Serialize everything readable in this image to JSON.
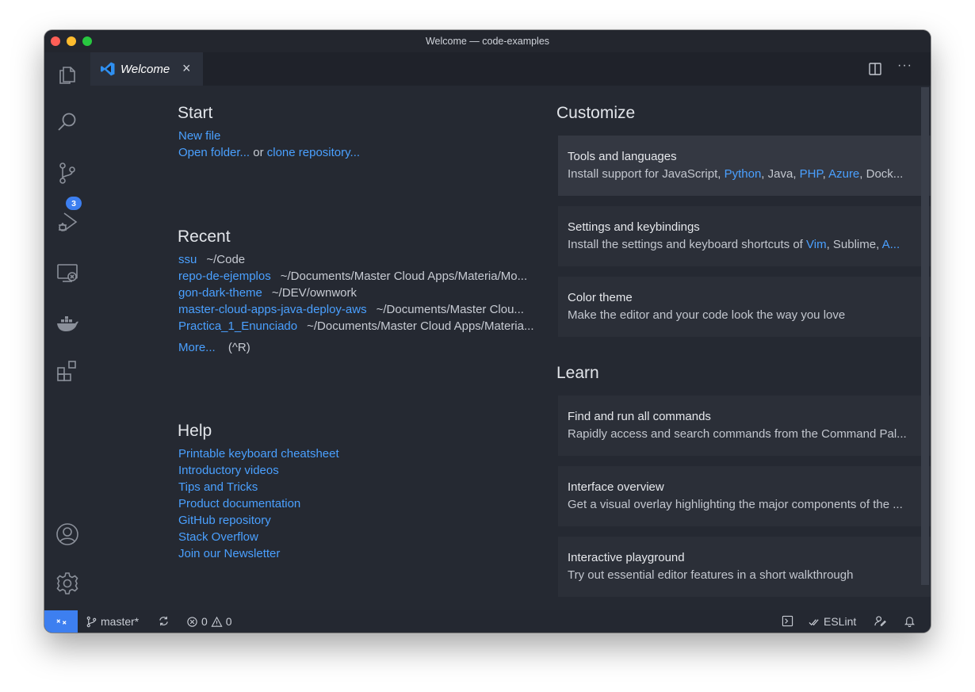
{
  "window": {
    "title": "Welcome — code-examples"
  },
  "activity_bar": {
    "items": [
      "files-icon",
      "search-icon",
      "source-control-icon",
      "run-debug-icon",
      "remote-explorer-icon",
      "docker-icon",
      "extensions-icon"
    ],
    "source_control_badge": "3",
    "bottom": [
      "account-icon",
      "settings-gear-icon"
    ]
  },
  "tabs": [
    {
      "label": "Welcome",
      "close": "×"
    }
  ],
  "tab_actions": {
    "more": "···"
  },
  "start": {
    "heading": "Start",
    "new_file": "New file",
    "open_folder": "Open folder...",
    "or": "or",
    "clone": "clone repository..."
  },
  "recent": {
    "heading": "Recent",
    "items": [
      {
        "name": "ssu",
        "path": "~/Code"
      },
      {
        "name": "repo-de-ejemplos",
        "path": "~/Documents/Master Cloud Apps/Materia/Mo..."
      },
      {
        "name": "gon-dark-theme",
        "path": "~/DEV/ownwork"
      },
      {
        "name": "master-cloud-apps-java-deploy-aws",
        "path": "~/Documents/Master Clou..."
      },
      {
        "name": "Practica_1_Enunciado",
        "path": "~/Documents/Master Cloud Apps/Materia..."
      }
    ],
    "more": "More...",
    "more_shortcut": "(^R)"
  },
  "help": {
    "heading": "Help",
    "links": [
      "Printable keyboard cheatsheet",
      "Introductory videos",
      "Tips and Tricks",
      "Product documentation",
      "GitHub repository",
      "Stack Overflow",
      "Join our Newsletter"
    ]
  },
  "customize": {
    "heading": "Customize",
    "cards": [
      {
        "title": "Tools and languages",
        "desc_parts": [
          {
            "t": "Install support for JavaScript, ",
            "link": false
          },
          {
            "t": "Python",
            "link": true
          },
          {
            "t": ", Java, ",
            "link": false
          },
          {
            "t": "PHP",
            "link": true
          },
          {
            "t": ", ",
            "link": false
          },
          {
            "t": "Azure",
            "link": true
          },
          {
            "t": ", Dock...",
            "link": false
          }
        ]
      },
      {
        "title": "Settings and keybindings",
        "desc_parts": [
          {
            "t": "Install the settings and keyboard shortcuts of ",
            "link": false
          },
          {
            "t": "Vim",
            "link": true
          },
          {
            "t": ", Sublime, ",
            "link": false
          },
          {
            "t": "A...",
            "link": true
          }
        ]
      },
      {
        "title": "Color theme",
        "desc_parts": [
          {
            "t": "Make the editor and your code look the way you love",
            "link": false
          }
        ]
      }
    ]
  },
  "learn": {
    "heading": "Learn",
    "cards": [
      {
        "title": "Find and run all commands",
        "desc": "Rapidly access and search commands from the Command Pal..."
      },
      {
        "title": "Interface overview",
        "desc": "Get a visual overlay highlighting the major components of the ..."
      },
      {
        "title": "Interactive playground",
        "desc": "Try out essential editor features in a short walkthrough"
      }
    ]
  },
  "status_bar": {
    "branch": "master*",
    "errors": "0",
    "warnings": "0",
    "eslint": "ESLint"
  },
  "colors": {
    "accent": "#3d7ff0",
    "link": "#4aa0ff",
    "editor_bg": "#252932"
  }
}
